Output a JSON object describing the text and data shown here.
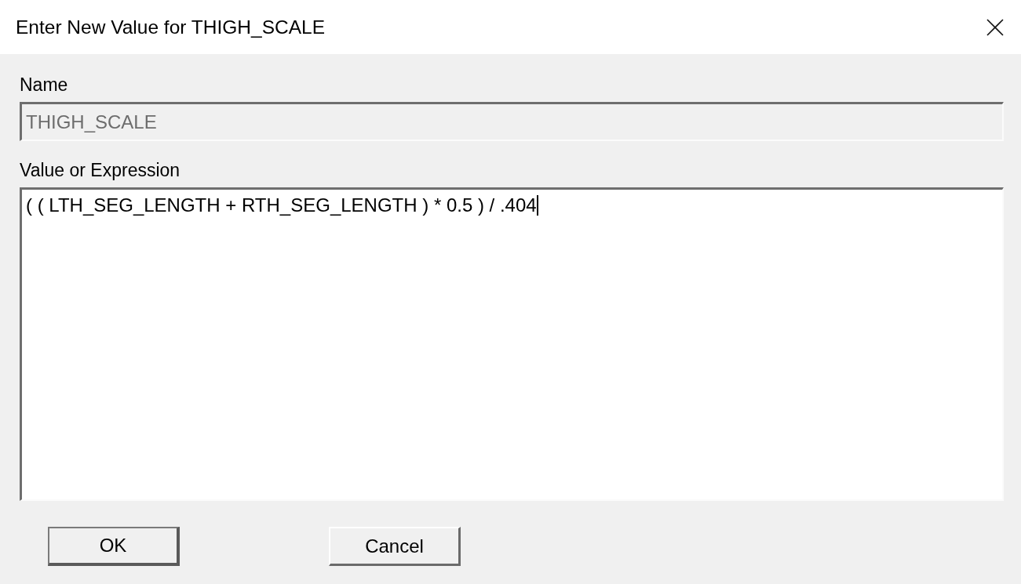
{
  "window": {
    "title": "Enter New Value for THIGH_SCALE"
  },
  "fields": [
    {
      "kind": "line",
      "label": "Name",
      "value": "THIGH_SCALE",
      "disabled": true,
      "focused": false
    },
    {
      "kind": "multiline",
      "label": "Value or Expression",
      "value": "( ( LTH_SEG_LENGTH + RTH_SEG_LENGTH ) * 0.5 ) / .404",
      "disabled": false,
      "focused": true
    }
  ],
  "buttons": [
    {
      "label": "OK",
      "default": true
    },
    {
      "label": "Cancel",
      "default": false
    }
  ]
}
